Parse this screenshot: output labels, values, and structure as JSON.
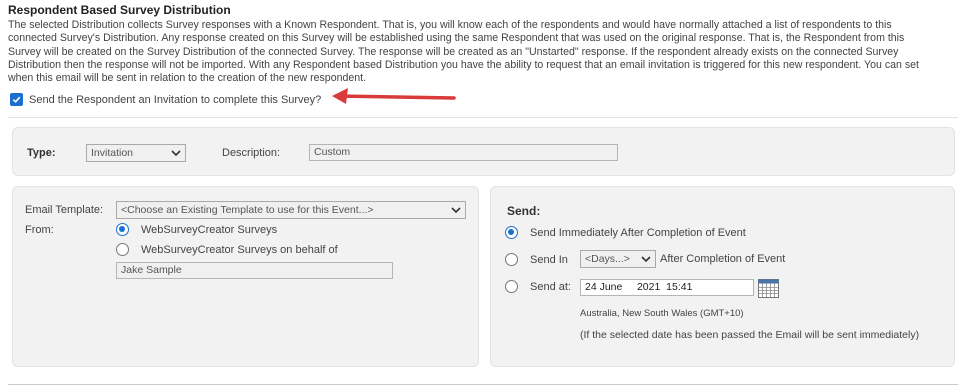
{
  "section": {
    "title": "Respondent Based Survey Distribution",
    "description_lines": [
      "The selected Distribution collects Survey responses with a Known Respondent. That is, you will know each of the respondents and would have normally attached a list of respondents to this",
      "connected Survey's Distribution. Any response created on this Survey will be established using the same Respondent that was used on the original response. That is, the Respondent from this",
      "Survey will be created on the Survey Distribution of the connected Survey. The response will be created as an \"Unstarted\" response. If the respondent already exists on the connected Survey",
      "Distribution then the response will not be imported. With any Respondent based Distribution you have the ability to request that an email invitation is triggered for this new respondent. You can set",
      "when this email will be sent in relation to the creation of the new respondent."
    ]
  },
  "invite": {
    "label": "Send the Respondent an Invitation to complete this Survey?",
    "checked": true
  },
  "type_panel": {
    "type_label": "Type:",
    "type_value": "Invitation",
    "description_label": "Description:",
    "description_value": "Custom"
  },
  "email_panel": {
    "template_label": "Email Template:",
    "template_value": "<Choose an Existing Template to use for this Event...>",
    "from_label": "From:",
    "from_option1": "WebSurveyCreator Surveys",
    "from_option2": "WebSurveyCreator Surveys on behalf of",
    "behalf_name": "Jake Sample"
  },
  "send_panel": {
    "title": "Send:",
    "option_immediately": "Send Immediately After Completion of Event",
    "option_send_in": "Send In",
    "days_value": "<Days...>",
    "after_completion": "After Completion of Event",
    "option_send_at": "Send at:",
    "date_value": "24 June     2021  15:41",
    "timezone": "Australia, New South Wales (GMT+10)",
    "note": "(If the selected date has been passed the Email will be sent immediately)"
  },
  "colors": {
    "accent": "#1a6fd1",
    "arrow": "#d93a3a",
    "panel_bg": "#f2f2f2"
  }
}
